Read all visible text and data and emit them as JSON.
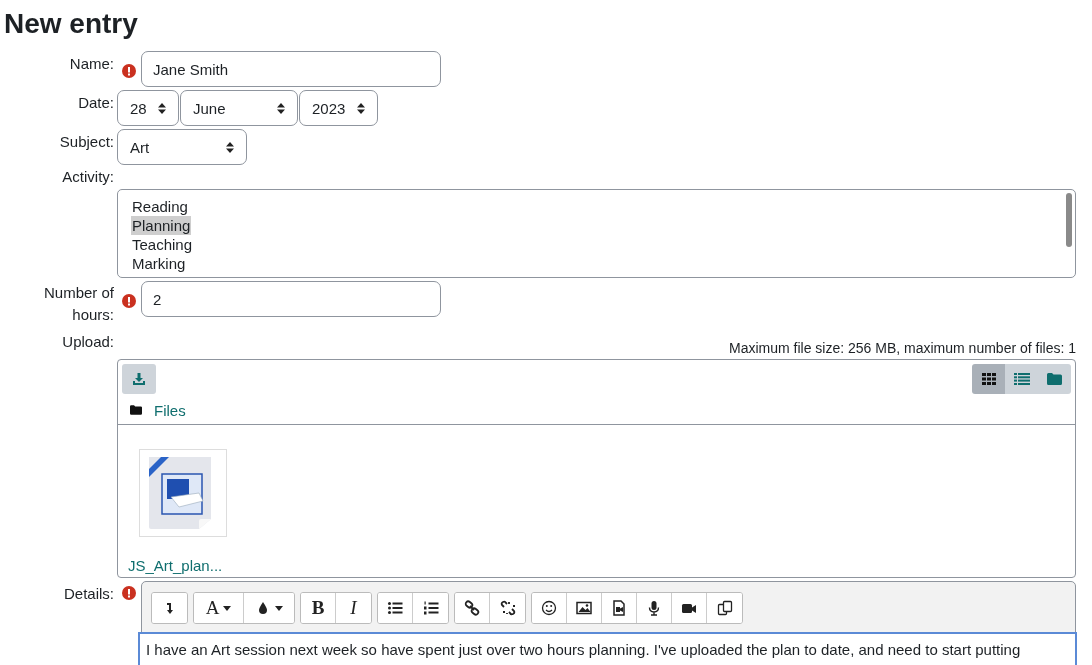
{
  "title": "New entry",
  "name": {
    "label": "Name:",
    "required": true,
    "value": "Jane Smith"
  },
  "date": {
    "label": "Date:",
    "day": "28",
    "month": "June",
    "year": "2023"
  },
  "subject": {
    "label": "Subject:",
    "value": "Art"
  },
  "activity": {
    "label": "Activity:",
    "options": [
      {
        "label": "Reading",
        "selected": false
      },
      {
        "label": "Planning",
        "selected": true
      },
      {
        "label": "Teaching",
        "selected": false
      },
      {
        "label": "Marking",
        "selected": false
      }
    ]
  },
  "hours": {
    "label_line1": "Number of",
    "label_line2": "hours:",
    "required": true,
    "value": "2"
  },
  "upload": {
    "label": "Upload:",
    "limits": "Maximum file size: 256 MB, maximum number of files: 1",
    "path": "Files",
    "views": [
      {
        "selected": true
      },
      {
        "selected": false
      },
      {
        "selected": false
      }
    ],
    "files": [
      {
        "name": "JS_Art_plan..."
      }
    ]
  },
  "details": {
    "label": "Details:",
    "required": true,
    "toolbar": [
      [
        {
          "kind": "icon"
        }
      ],
      [
        {
          "kind": "glyph-menu",
          "label": "A"
        },
        {
          "kind": "icon-menu"
        }
      ],
      [
        {
          "kind": "glyph",
          "label": "B"
        },
        {
          "kind": "glyph",
          "label": "I"
        }
      ],
      [
        {
          "kind": "icon"
        },
        {
          "kind": "icon"
        }
      ],
      [
        {
          "kind": "icon"
        },
        {
          "kind": "icon"
        }
      ],
      [
        {
          "kind": "icon"
        },
        {
          "kind": "icon"
        },
        {
          "kind": "icon"
        },
        {
          "kind": "icon"
        },
        {
          "kind": "icon"
        },
        {
          "kind": "icon"
        }
      ]
    ],
    "text": "I have an Art session next week so have spent just over two hours planning. I've uploaded the plan to date, and need to start putting"
  }
}
